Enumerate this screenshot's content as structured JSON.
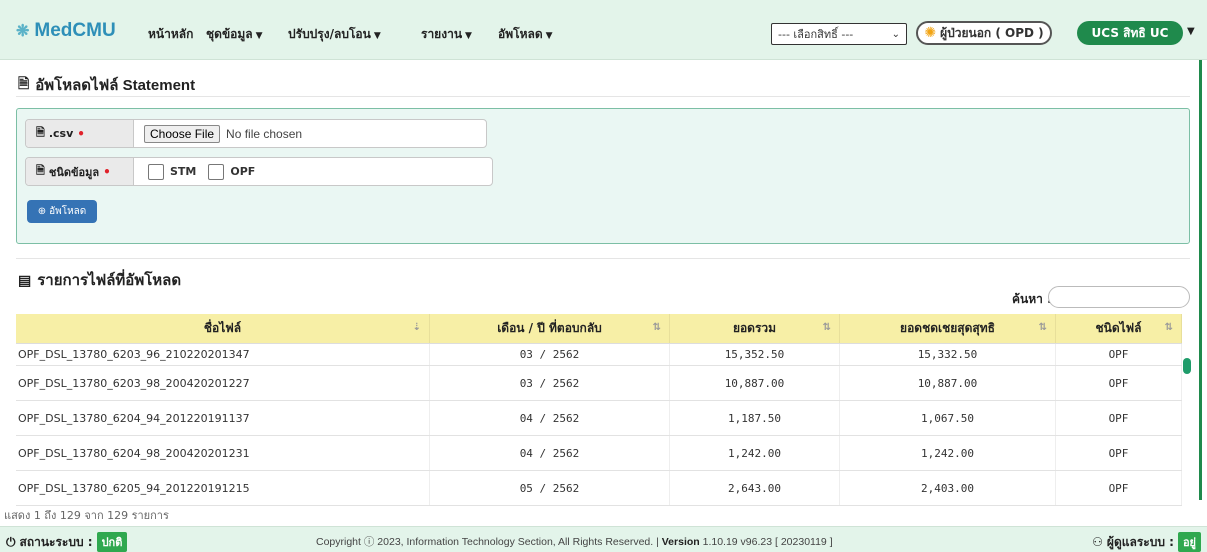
{
  "nav": {
    "brand": "MedCMU",
    "brand_icon": "flower-logo-icon",
    "items": [
      {
        "label": "หน้าหลัก",
        "dropdown": false
      },
      {
        "label": "ชุดข้อมูล",
        "dropdown": true
      },
      {
        "label": "ปรับปรุง/ลบโอน",
        "dropdown": true
      },
      {
        "label": "รายงาน",
        "dropdown": true
      },
      {
        "label": "อัพโหลด",
        "dropdown": true
      }
    ],
    "role_select": "--- เลือกสิทธิ์ ---",
    "opd_label": "ผู้ป่วยนอก ( OPD )",
    "ucs_label": "UCS สิทธิ UC"
  },
  "upload_section": {
    "title": "อัพโหลดไฟล์ Statement",
    "csv_label": ".csv",
    "file_button": "Choose File",
    "file_status": "No file chosen",
    "type_label": "ชนิดข้อมูล",
    "options": [
      "STM",
      "OPF"
    ],
    "upload_button": "อัพโหลด"
  },
  "list_section": {
    "title": "รายการไฟล์ที่อัพโหลด",
    "search_label": "ค้นหา :",
    "columns": [
      "ชื่อไฟล์",
      "เดือน / ปี ที่ตอบกลับ",
      "ยอดรวม",
      "ยอดชดเชยสุดสุทธิ",
      "ชนิดไฟล์"
    ],
    "rows": [
      [
        "OPF_DSL_13780_6203_96_210220201347",
        "03 / 2562",
        "15,352.50",
        "15,332.50",
        "OPF"
      ],
      [
        "OPF_DSL_13780_6203_98_200420201227",
        "03 / 2562",
        "10,887.00",
        "10,887.00",
        "OPF"
      ],
      [
        "OPF_DSL_13780_6204_94_201220191137",
        "04 / 2562",
        "1,187.50",
        "1,067.50",
        "OPF"
      ],
      [
        "OPF_DSL_13780_6204_98_200420201231",
        "04 / 2562",
        "1,242.00",
        "1,242.00",
        "OPF"
      ],
      [
        "OPF_DSL_13780_6205_94_201220191215",
        "05 / 2562",
        "2,643.00",
        "2,403.00",
        "OPF"
      ]
    ],
    "info": "แสดง 1 ถึง 129 จาก 129 รายการ"
  },
  "footer": {
    "status_label": "สถานะระบบ :",
    "status_value": "ปกติ",
    "copyright_prefix": "Copyright",
    "copyright_text": "2023, Information Technology Section, All Rights Reserved. |",
    "version_label": "Version",
    "version_value": "1.10.19 v96.23 [ 20230119 ]",
    "admin_label": "ผู้ดูแลระบบ :",
    "admin_value": "อยู่"
  },
  "colors": {
    "nav_bg": "#e3f4ea",
    "brand": "#2e8fb8",
    "accent_green": "#1f8a4c",
    "upload_button": "#3573b5",
    "table_header": "#f7efa6"
  }
}
